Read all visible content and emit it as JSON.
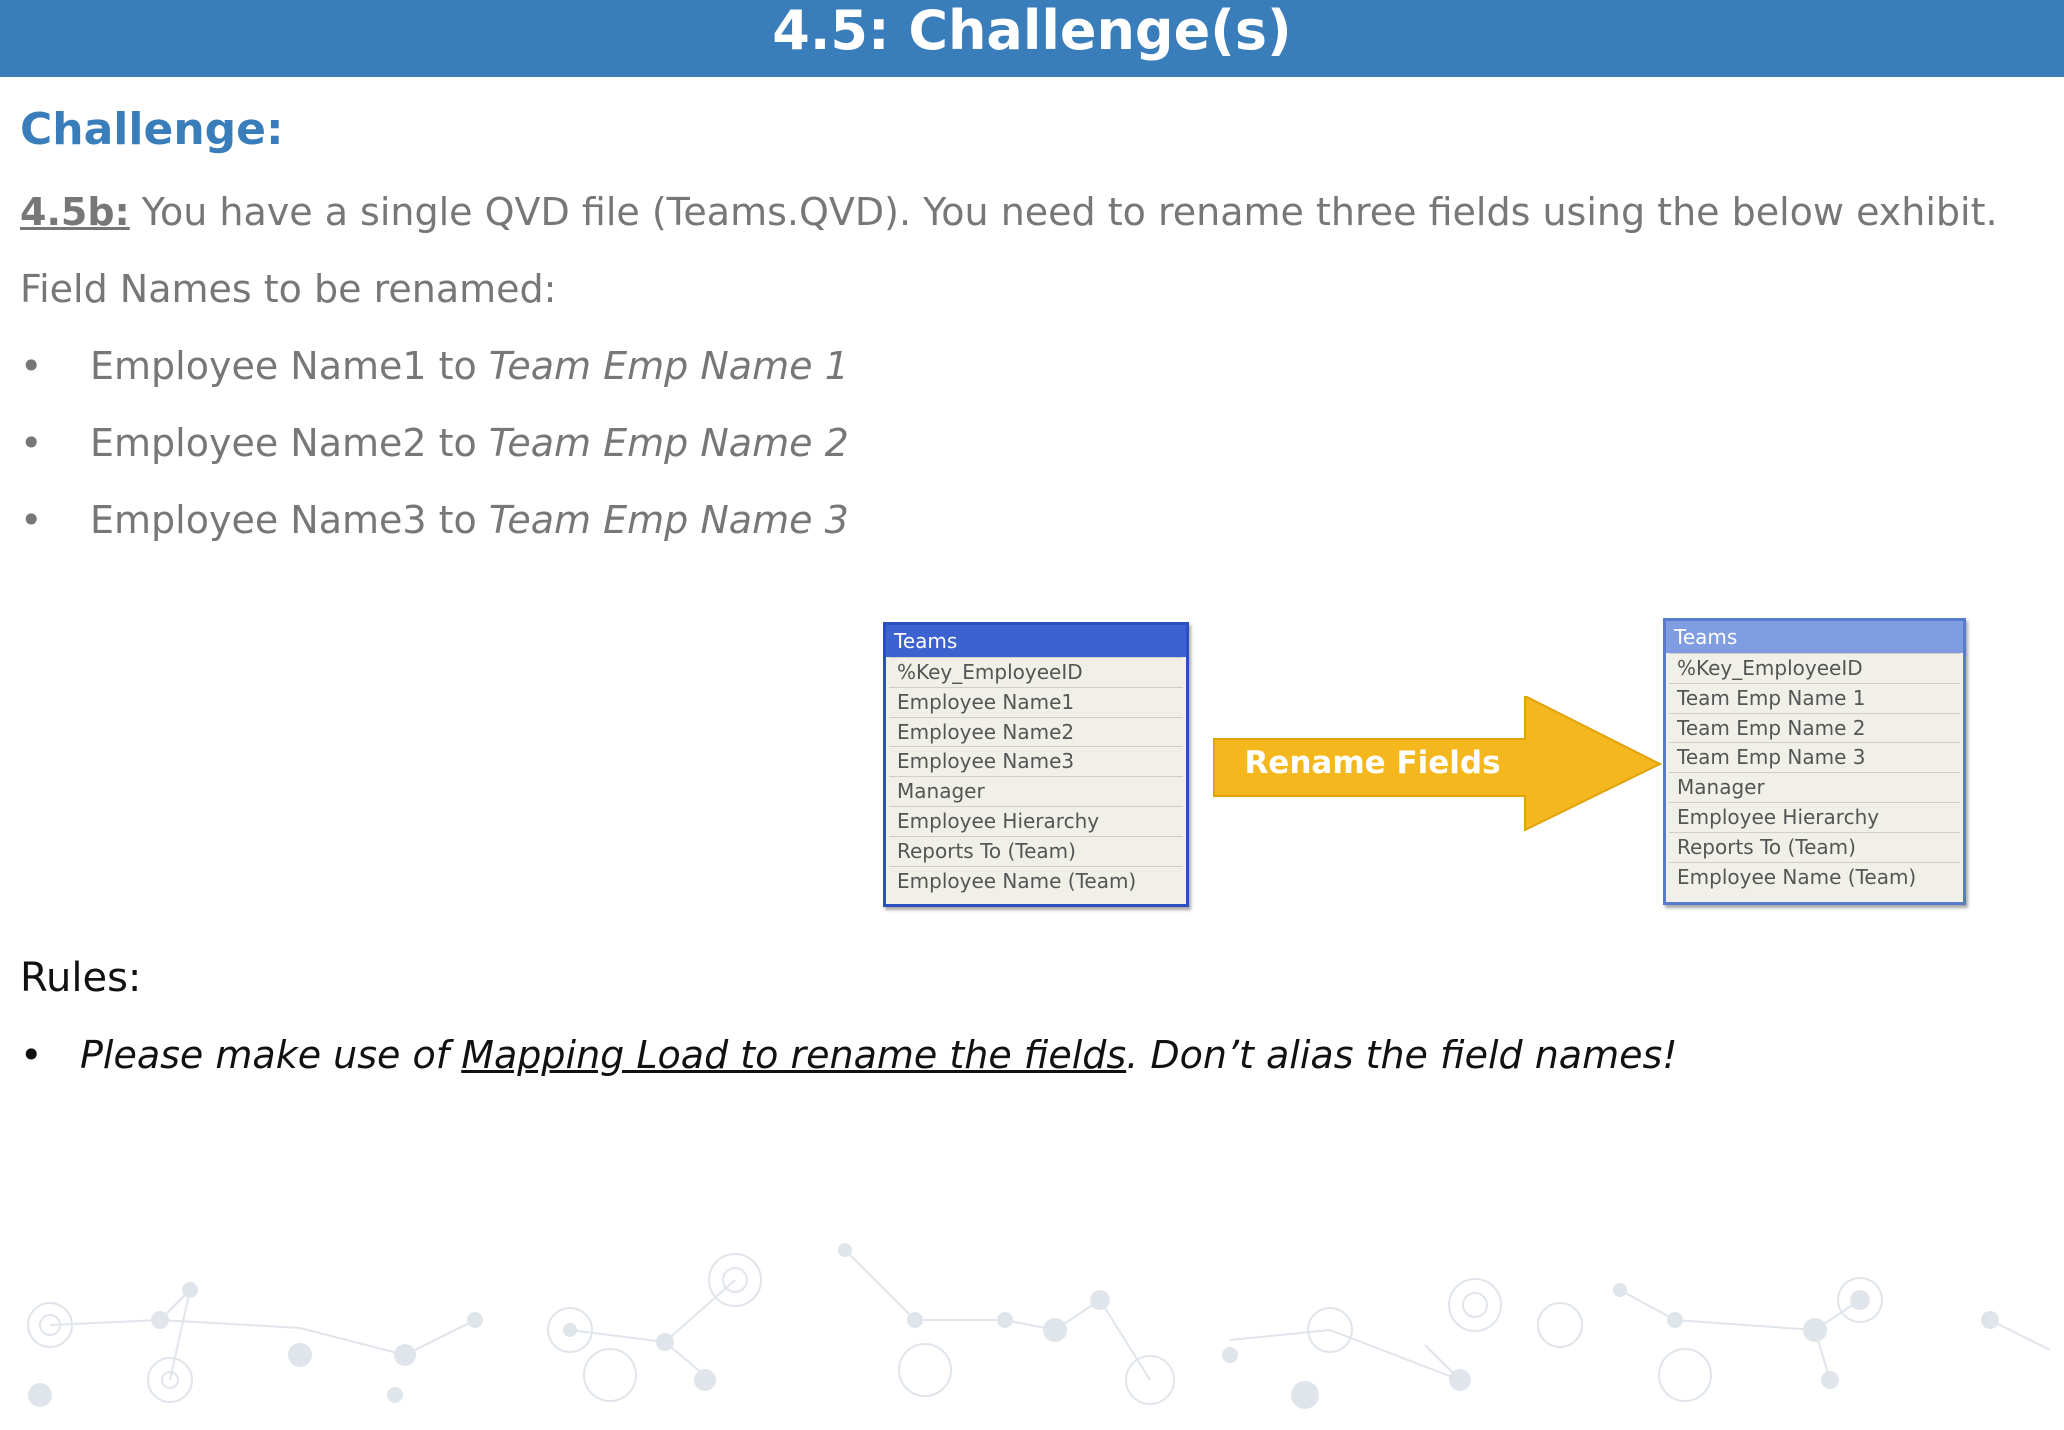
{
  "header": {
    "title": "4.5: Challenge(s)"
  },
  "challenge": {
    "heading": "Challenge:",
    "id_label": "4.5b:",
    "description": " You have a single QVD file (Teams.QVD). You need to rename three fields using the below exhibit.",
    "subheading": "Field Names to be renamed:",
    "renames": [
      {
        "from": "Employee Name1 to ",
        "to": "Team Emp Name 1"
      },
      {
        "from": "Employee Name2 to ",
        "to": "Team Emp Name 2"
      },
      {
        "from": "Employee Name3 to ",
        "to": "Team Emp Name 3"
      }
    ]
  },
  "exhibit": {
    "before": {
      "title": "Teams",
      "fields": [
        "%Key_EmployeeID",
        "Employee Name1",
        "Employee Name2",
        "Employee Name3",
        "Manager",
        "Employee Hierarchy",
        "Reports To (Team)",
        "Employee Name (Team)"
      ]
    },
    "arrow_label": "Rename Fields",
    "after": {
      "title": "Teams",
      "fields": [
        "%Key_EmployeeID",
        "Team Emp Name 1",
        "Team Emp Name 2",
        "Team Emp Name 3",
        "Manager",
        "Employee Hierarchy",
        "Reports To (Team)",
        "Employee Name (Team)"
      ]
    },
    "arrow_color": "#f4b81e"
  },
  "rules": {
    "heading": "Rules:",
    "bullet": "•",
    "item_before": "Please make use of ",
    "item_link": "Mapping Load to rename the fields",
    "item_after": ". Don’t alias the field names!"
  },
  "colors": {
    "header": "#3a7dbb",
    "accent": "#3a7dbb",
    "body_text": "#777777"
  }
}
